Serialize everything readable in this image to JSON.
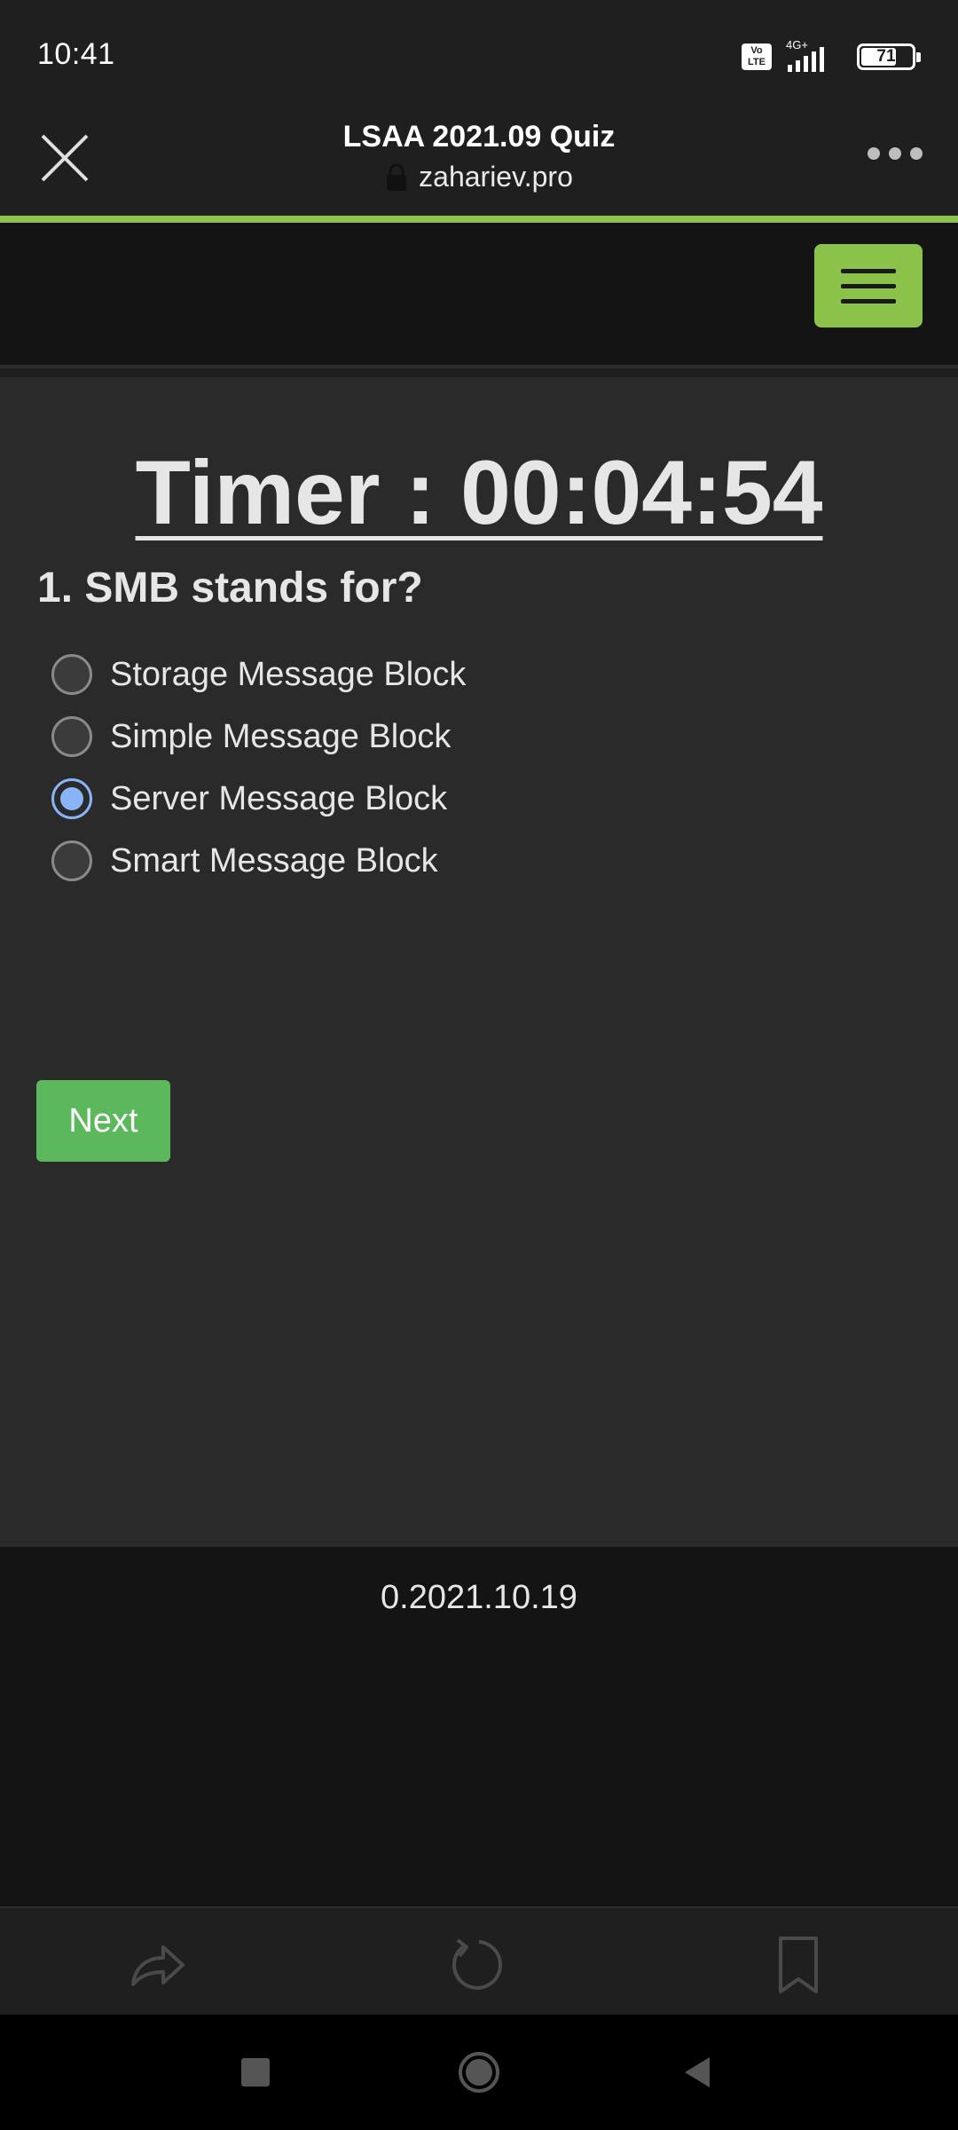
{
  "status_bar": {
    "time": "10:41",
    "network_label": "4G+",
    "volte_label": "Vo\nLTE",
    "battery_percent": "71",
    "battery_level": 0.71
  },
  "browser": {
    "title": "LSAA 2021.09 Quiz",
    "url": "zahariev.pro",
    "icons": {
      "close": "close-icon",
      "lock": "lock-icon",
      "more": "more-dots-icon",
      "menu": "hamburger-menu-icon",
      "share": "share-icon",
      "refresh": "refresh-icon",
      "bookmark": "bookmark-icon"
    },
    "accent_color": "#8bc34a"
  },
  "quiz": {
    "timer": "Timer : 00:04:54",
    "question": "1. SMB stands for?",
    "options": [
      {
        "label": "Storage Message Block",
        "checked": false
      },
      {
        "label": "Simple Message Block",
        "checked": false
      },
      {
        "label": "Server Message Block",
        "checked": true
      },
      {
        "label": "Smart Message Block",
        "checked": false
      }
    ],
    "next_label": "Next",
    "next_color": "#5cb85c"
  },
  "footer": {
    "version": "0.2021.10.19"
  },
  "system_nav": {
    "icons": [
      "recents-square-icon",
      "home-circle-icon",
      "back-triangle-icon"
    ]
  }
}
